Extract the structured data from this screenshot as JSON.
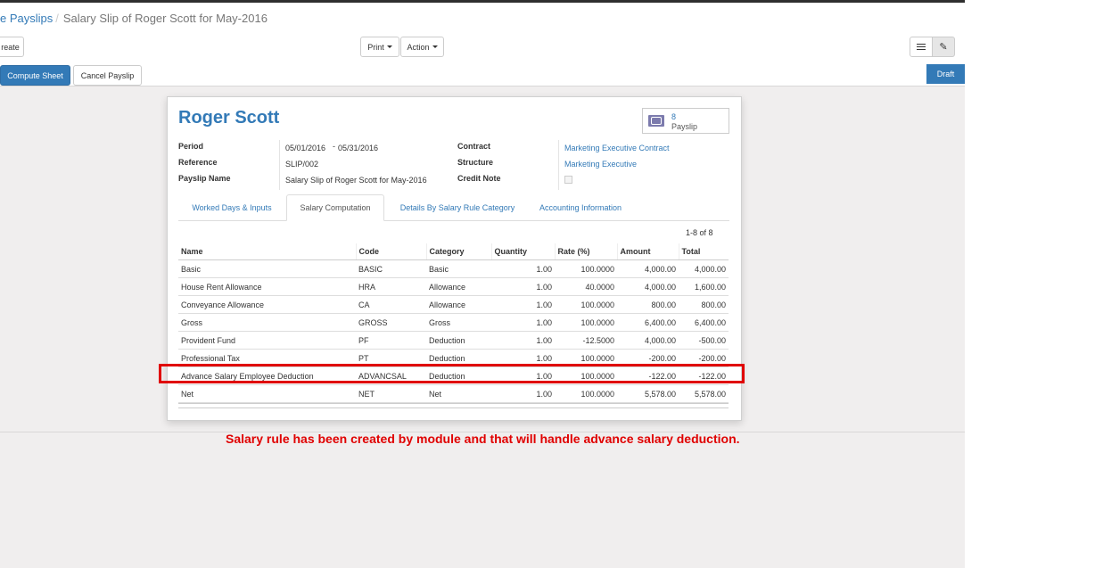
{
  "breadcrumb": {
    "parent": "e Payslips",
    "separator": "/",
    "current": "Salary Slip of Roger Scott for May-2016"
  },
  "toolbar": {
    "create_label": "reate",
    "print_label": "Print",
    "action_label": "Action"
  },
  "view_switcher": {
    "list_icon": "list-icon",
    "form_icon": "edit-icon"
  },
  "statusbar": {
    "compute_label": "Compute Sheet",
    "cancel_label": "Cancel Payslip",
    "state_label": "Draft"
  },
  "form": {
    "employee_name": "Roger Scott",
    "smart_button": {
      "value": "8",
      "label": "Payslip",
      "icon": "money-icon"
    },
    "fields_left": {
      "period_label": "Period",
      "date_from": "05/01/2016",
      "date_sep": "-",
      "date_to": "05/31/2016",
      "reference_label": "Reference",
      "reference_value": "SLIP/002",
      "payslip_name_label": "Payslip Name",
      "payslip_name_value": "Salary Slip of Roger Scott for May-2016"
    },
    "fields_right": {
      "contract_label": "Contract",
      "contract_value": "Marketing Executive Contract",
      "structure_label": "Structure",
      "structure_value": "Marketing Executive",
      "credit_note_label": "Credit Note"
    }
  },
  "tabs": [
    "Worked Days & Inputs",
    "Salary Computation",
    "Details By Salary Rule Category",
    "Accounting Information"
  ],
  "pager": "1-8 of 8",
  "table": {
    "columns": [
      "Name",
      "Code",
      "Category",
      "Quantity",
      "Rate (%)",
      "Amount",
      "Total"
    ],
    "rows": [
      [
        "Basic",
        "BASIC",
        "Basic",
        "1.00",
        "100.0000",
        "4,000.00",
        "4,000.00"
      ],
      [
        "House Rent Allowance",
        "HRA",
        "Allowance",
        "1.00",
        "40.0000",
        "4,000.00",
        "1,600.00"
      ],
      [
        "Conveyance Allowance",
        "CA",
        "Allowance",
        "1.00",
        "100.0000",
        "800.00",
        "800.00"
      ],
      [
        "Gross",
        "GROSS",
        "Gross",
        "1.00",
        "100.0000",
        "6,400.00",
        "6,400.00"
      ],
      [
        "Provident Fund",
        "PF",
        "Deduction",
        "1.00",
        "-12.5000",
        "4,000.00",
        "-500.00"
      ],
      [
        "Professional Tax",
        "PT",
        "Deduction",
        "1.00",
        "100.0000",
        "-200.00",
        "-200.00"
      ],
      [
        "Advance Salary Employee Deduction",
        "ADVANCSAL",
        "Deduction",
        "1.00",
        "100.0000",
        "-122.00",
        "-122.00"
      ],
      [
        "Net",
        "NET",
        "Net",
        "1.00",
        "100.0000",
        "5,578.00",
        "5,578.00"
      ]
    ]
  },
  "annotation": {
    "note": "Salary rule has been created by module and that will handle advance salary deduction.",
    "color": "#e00000"
  },
  "colors": {
    "primary": "#337ab7",
    "background": "#f0eeee"
  }
}
